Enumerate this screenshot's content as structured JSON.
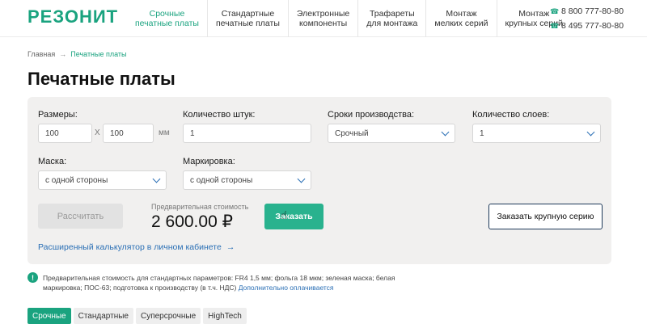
{
  "header": {
    "logo": "РЕЗОНИТ",
    "nav": [
      {
        "line1": "Срочные",
        "line2": "печатные платы",
        "active": true
      },
      {
        "line1": "Стандартные",
        "line2": "печатные платы",
        "active": false
      },
      {
        "line1": "Электронные",
        "line2": "компоненты",
        "active": false
      },
      {
        "line1": "Трафареты",
        "line2": "для монтажа",
        "active": false
      },
      {
        "line1": "Монтаж",
        "line2": "мелких серий",
        "active": false
      },
      {
        "line1": "Монтаж",
        "line2": "крупных серий",
        "active": false
      }
    ],
    "phones": [
      "8 800 777-80-80",
      "8 495 777-80-80"
    ]
  },
  "breadcrumb": {
    "home": "Главная",
    "arrow": "→",
    "current": "Печатные платы"
  },
  "page_title": "Печатные платы",
  "calculator": {
    "size_label": "Размеры:",
    "size_x": "100",
    "size_sep": "X",
    "size_y": "100",
    "size_unit": "мм",
    "qty_label": "Количество штук:",
    "qty_value": "1",
    "term_label": "Сроки производства:",
    "term_value": "Срочный",
    "layers_label": "Количество слоев:",
    "layers_value": "1",
    "mask_label": "Маска:",
    "mask_value": "с одной стороны",
    "marking_label": "Маркировка:",
    "marking_value": "с одной стороны",
    "calc_button": "Рассчитать",
    "price_label": "Предварительная стоимость",
    "price": "2 600.00 ₽",
    "order_button": "Заказать",
    "big_order_button": "Заказать крупную серию",
    "ext_link": "Расширенный калькулятор в личном кабинете",
    "ext_arrow": "→"
  },
  "note": {
    "icon": "!",
    "text": "Предварительная стоимость для стандартных параметров: FR4 1,5 мм; фольга 18 мкм; зеленая маска; белая маркировка; ПОС-63; подготовка к производству (в т.ч. НДС) ",
    "link": "Дополнительно оплачивается"
  },
  "tabs": [
    {
      "label": "Срочные",
      "active": true
    },
    {
      "label": "Стандартные",
      "active": false
    },
    {
      "label": "Суперсрочные",
      "active": false
    },
    {
      "label": "HighTech",
      "active": false
    }
  ],
  "colors": {
    "brand": "#1aa37f",
    "button": "#29b28e",
    "link": "#2a6fb5",
    "panel": "#f1f0ef"
  }
}
